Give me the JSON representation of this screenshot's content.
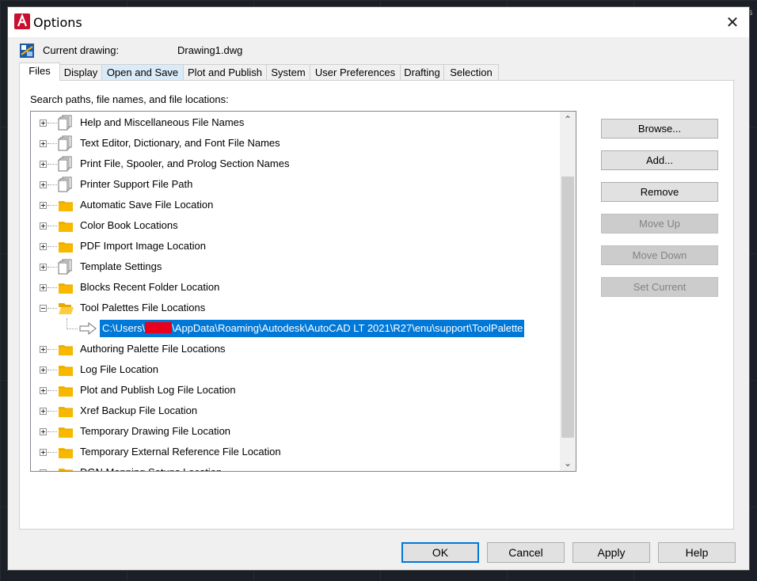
{
  "dialog": {
    "title": "Options",
    "close_glyph": "✕"
  },
  "current_drawing": {
    "label": "Current drawing:",
    "value": "Drawing1.dwg"
  },
  "tabs": [
    "Files",
    "Display",
    "Open and Save",
    "Plot and Publish",
    "System",
    "User Preferences",
    "Drafting",
    "Selection"
  ],
  "files": {
    "search_label": "Search paths, file names, and file locations:",
    "tree": [
      {
        "label": "Help and Miscellaneous File Names",
        "icon": "multi-file-icon",
        "expanded": false
      },
      {
        "label": "Text Editor, Dictionary, and Font File Names",
        "icon": "multi-file-icon",
        "expanded": false
      },
      {
        "label": "Print File, Spooler, and Prolog Section Names",
        "icon": "multi-file-icon",
        "expanded": false
      },
      {
        "label": "Printer Support File Path",
        "icon": "multi-file-icon",
        "expanded": false
      },
      {
        "label": "Automatic Save File Location",
        "icon": "folder-icon",
        "expanded": false
      },
      {
        "label": "Color Book Locations",
        "icon": "folder-icon",
        "expanded": false
      },
      {
        "label": "PDF Import Image Location",
        "icon": "folder-icon",
        "expanded": false
      },
      {
        "label": "Template Settings",
        "icon": "multi-file-icon",
        "expanded": false
      },
      {
        "label": "Blocks Recent Folder Location",
        "icon": "folder-icon",
        "expanded": false
      },
      {
        "label": "Tool Palettes File Locations",
        "icon": "open-folder-icon",
        "expanded": true
      },
      {
        "label": "Authoring Palette File Locations",
        "icon": "folder-icon",
        "expanded": false
      },
      {
        "label": "Log File Location",
        "icon": "folder-icon",
        "expanded": false
      },
      {
        "label": "Plot and Publish Log File Location",
        "icon": "folder-icon",
        "expanded": false
      },
      {
        "label": "Xref Backup File Location",
        "icon": "folder-icon",
        "expanded": false
      },
      {
        "label": "Temporary Drawing File Location",
        "icon": "folder-icon",
        "expanded": false
      },
      {
        "label": "Temporary External Reference File Location",
        "icon": "folder-icon",
        "expanded": false
      },
      {
        "label": "DGN Mapping Setups Location",
        "icon": "folder-icon",
        "expanded": false
      }
    ],
    "selected_path_prefix": "C:\\Users\\",
    "selected_path_suffix": "\\AppData\\Roaming\\Autodesk\\AutoCAD LT 2021\\R27\\enu\\support\\ToolPalette"
  },
  "side_buttons": [
    {
      "label": "Browse...",
      "enabled": true
    },
    {
      "label": "Add...",
      "enabled": true
    },
    {
      "label": "Remove",
      "enabled": true
    },
    {
      "label": "Move Up",
      "enabled": false
    },
    {
      "label": "Move Down",
      "enabled": false
    },
    {
      "label": "Set Current",
      "enabled": false
    }
  ],
  "bottom_buttons": {
    "ok": "OK",
    "cancel": "Cancel",
    "apply": "Apply",
    "help": "Help"
  },
  "colors": {
    "accent": "#0078d7",
    "folder": "#f8b800",
    "redaction": "#e8001c"
  }
}
